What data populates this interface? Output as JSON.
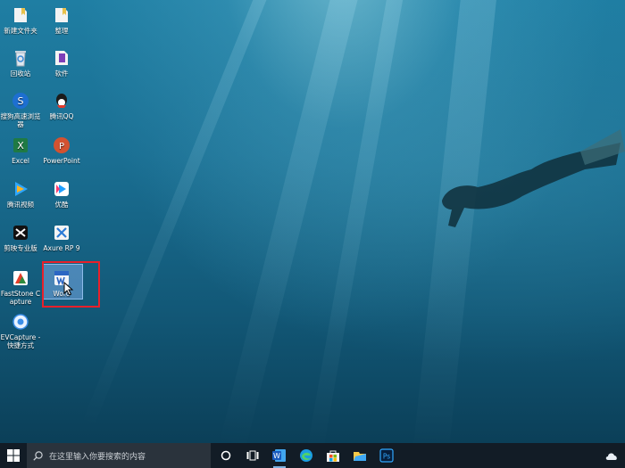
{
  "desktop": {
    "icons": [
      {
        "label": "新建文件夹",
        "icon": "folder-icon"
      },
      {
        "label": "整理",
        "icon": "folder-icon"
      },
      {
        "label": "回收站",
        "icon": "recycle-bin-icon"
      },
      {
        "label": "软件",
        "icon": "software-folder-icon"
      },
      {
        "label": "搜狗高速浏览器",
        "icon": "sogou-browser-icon"
      },
      {
        "label": "腾讯QQ",
        "icon": "qq-icon"
      },
      {
        "label": "Excel",
        "icon": "excel-icon"
      },
      {
        "label": "PowerPoint",
        "icon": "powerpoint-icon"
      },
      {
        "label": "腾讯视频",
        "icon": "tencent-video-icon"
      },
      {
        "label": "优酷",
        "icon": "youku-icon"
      },
      {
        "label": "剪映专业版",
        "icon": "capcut-icon"
      },
      {
        "label": "Axure RP 9",
        "icon": "axure-icon"
      },
      {
        "label": "FastStone Capture",
        "icon": "faststone-icon"
      },
      {
        "label": "Word",
        "icon": "word-shortcut-icon"
      },
      {
        "label": "EVCapture - 快捷方式",
        "icon": "evcapture-icon"
      }
    ],
    "selected": "Word",
    "colors": {
      "highlight_box": "#e8202a",
      "selection": "#78aae6"
    }
  },
  "taskbar": {
    "search_placeholder": "在这里输入你要搜索的内容",
    "buttons": [
      {
        "name": "cortana",
        "icon": "circle-icon"
      },
      {
        "name": "task-view",
        "icon": "task-view-icon"
      },
      {
        "name": "word",
        "icon": "word-icon"
      },
      {
        "name": "edge",
        "icon": "edge-icon"
      },
      {
        "name": "store",
        "icon": "store-icon"
      },
      {
        "name": "explorer",
        "icon": "file-explorer-icon"
      },
      {
        "name": "photoshop",
        "icon": "photoshop-icon",
        "text": "Ps"
      }
    ],
    "colors": {
      "background": "#121c26",
      "search_bg": "#2a333c"
    }
  }
}
